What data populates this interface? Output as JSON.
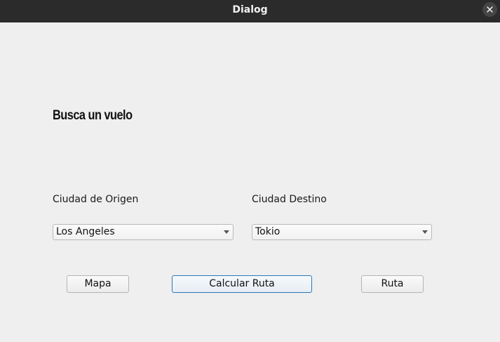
{
  "window": {
    "title": "Dialog"
  },
  "form": {
    "heading": "Busca un vuelo",
    "origin_label": "Ciudad de Origen",
    "origin_value": "Los Angeles",
    "destination_label": "Ciudad Destino",
    "destination_value": "Tokio"
  },
  "buttons": {
    "map": "Mapa",
    "calculate": "Calcular Ruta",
    "route": "Ruta"
  },
  "colors": {
    "titlebar": "#2b2b2b",
    "background": "#efefef",
    "default_button_border": "#2a78b8"
  },
  "icons": {
    "close": "close-icon",
    "dropdown": "chevron-down-icon"
  }
}
